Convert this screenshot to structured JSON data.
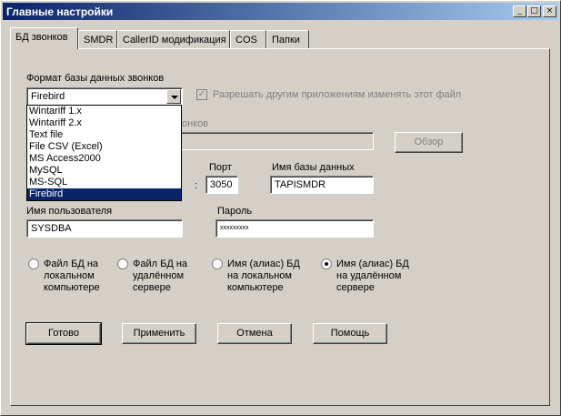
{
  "window": {
    "title": "Главные настройки",
    "controls": {
      "minimize": "_",
      "maximize": "□",
      "close": "×"
    }
  },
  "tabs": [
    {
      "label": "БД звонков",
      "active": true
    },
    {
      "label": "SMDR"
    },
    {
      "label": "CallerID модификация"
    },
    {
      "label": "COS"
    },
    {
      "label": "Папки"
    }
  ],
  "db_format": {
    "label": "Формат базы данных звонков",
    "selected": "Firebird",
    "options": [
      "Wintariff 1.x",
      "Wintariff 2.x",
      "Text file",
      "File CSV (Excel)",
      "MS Access2000",
      "MySQL",
      "MS-SQL",
      "Firebird"
    ],
    "allow_others_label": "Разрешать другим приложениям изменять этот файл",
    "allow_others_checked": true
  },
  "db_file": {
    "label_tail": "онков",
    "browse": "Обзор"
  },
  "server": {
    "port_label": "Порт",
    "port_value": "3050",
    "separator": ":",
    "dbname_label": "Имя базы данных",
    "dbname_value": "TAPISMDR"
  },
  "user": {
    "label": "Имя пользователя",
    "value": "SYSDBA"
  },
  "password": {
    "label": "Пароль",
    "value": "xxxxxxxxx"
  },
  "location": {
    "options": [
      {
        "label": "Файл БД на локальном компьютере",
        "checked": false
      },
      {
        "label": "Файл БД на удалённом сервере",
        "checked": false
      },
      {
        "label": "Имя (алиас) БД на локальном компьютере",
        "checked": false
      },
      {
        "label": "Имя (алиас) БД на удалённом сервере",
        "checked": true
      }
    ]
  },
  "buttons": {
    "ok": "Готово",
    "apply": "Применить",
    "cancel": "Отмена",
    "help": "Помощь"
  },
  "colors": {
    "face": "#d4d0c8",
    "title_start": "#0a246a",
    "title_end": "#a6caf0",
    "selection": "#0a246a"
  }
}
